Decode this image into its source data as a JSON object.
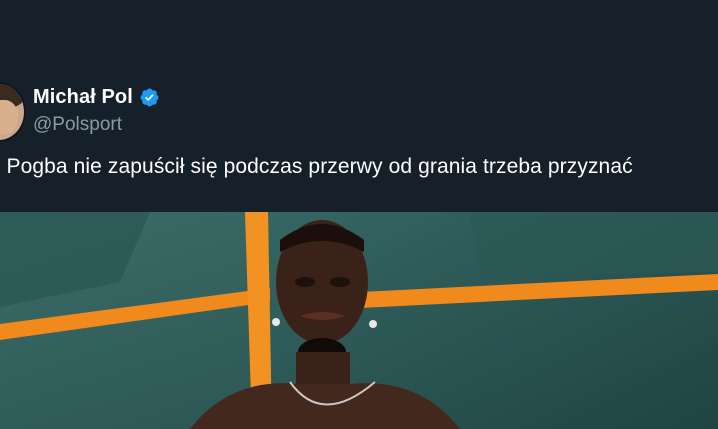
{
  "tweet": {
    "author": {
      "display_name": "Michał Pol",
      "handle": "@Polsport",
      "verified_icon": "verified-badge-icon",
      "avatar_icon": "avatar"
    },
    "text": "ul Pogba nie zapuścił się podczas przerwy od grania trzeba przyznać",
    "media": {
      "description_icon": "tweet-photo"
    }
  },
  "colors": {
    "background": "#16202b",
    "text_primary": "#ffffff",
    "text_secondary": "#8b98a5",
    "verified_blue": "#1d9bf0"
  }
}
